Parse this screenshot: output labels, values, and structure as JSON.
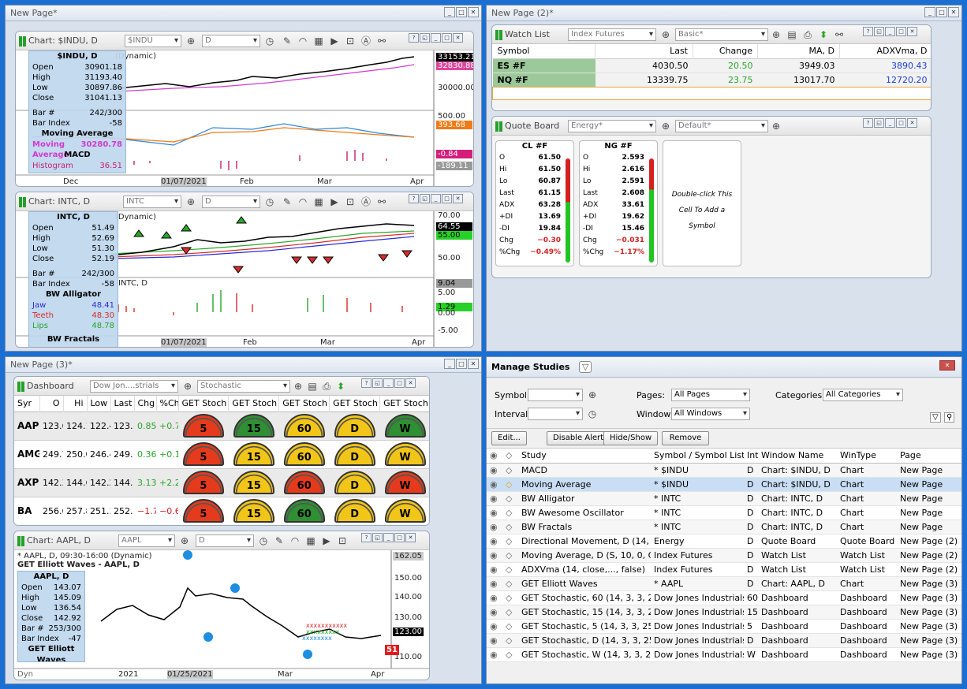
{
  "win1": {
    "title": "New Page*"
  },
  "win2": {
    "title": "New Page (2)*"
  },
  "win3": {
    "title": "New Page (3)*"
  },
  "chart_indu": {
    "title": "Chart: $INDU, D",
    "symbol": "$INDU",
    "interval": "D",
    "legend_title": "$INDU, D",
    "rows": [
      [
        "Open",
        "30901.18"
      ],
      [
        "High",
        "31193.40"
      ],
      [
        "Low",
        "30897.86"
      ],
      [
        "Close",
        "31041.13"
      ]
    ],
    "rows2": [
      [
        "Bar #",
        "242/300"
      ],
      [
        "Bar Index",
        "-58"
      ]
    ],
    "ma_title": "Moving Average",
    "ma_label": "Moving Average",
    "ma_value": "30280.78",
    "macd_title": "MACD",
    "hist_label": "Histogram",
    "hist_value": "36.51",
    "ghost1": "$INDU, D",
    "ghost2": "Moving Average",
    "ghost3": "(Dynamic)",
    "price_ticks": [
      "33153.21",
      "32830.88",
      "30000.00"
    ],
    "ind_ticks": [
      "500.00",
      "393.68",
      "-0.84",
      "-189.11"
    ],
    "xlabels": [
      "Dec",
      "01/07/2021",
      "Feb",
      "Mar",
      "Apr"
    ],
    "dyn": "D"
  },
  "chart_intc": {
    "title": "Chart: INTC, D",
    "symbol": "INTC",
    "interval": "D",
    "legend_title": "INTC, D",
    "rows": [
      [
        "Open",
        "51.49"
      ],
      [
        "High",
        "52.69"
      ],
      [
        "Low",
        "51.30"
      ],
      [
        "Close",
        "52.19"
      ]
    ],
    "rows2": [
      [
        "Bar #",
        "242/300"
      ],
      [
        "Bar Index",
        "-58"
      ]
    ],
    "alli_title": "BW Alligator",
    "alli": [
      [
        "Jaw",
        "48.41"
      ],
      [
        "Teeth",
        "48.30"
      ],
      [
        "Lips",
        "48.78"
      ]
    ],
    "fract_title": "BW Fractals",
    "sub_label": "INTC, D",
    "ghost1": "INTC, D",
    "ghost2": "Alligator - INTC, D",
    "ghost3": "Fractals - INTC, D",
    "ghost4": "Awesome Oscillator",
    "ghost5": "(Dynamic)",
    "price_ticks": [
      "70.00",
      "64.55",
      "55.00",
      "50.00"
    ],
    "ind_ticks": [
      "9.04",
      "5.00",
      "1.29",
      "0.00",
      "-5.00"
    ],
    "xlabels": [
      "01/07/2021",
      "Feb",
      "Mar",
      "Apr"
    ],
    "dyn": "D"
  },
  "watchlist": {
    "title": "Watch List",
    "list": "Index Futures",
    "columns_set": "Basic*",
    "headers": [
      "Symbol",
      "Last",
      "Change",
      "MA, D",
      "ADXVma, D"
    ],
    "rows": [
      [
        "ES #F",
        "4030.50",
        "20.50",
        "3949.03",
        "3890.43"
      ],
      [
        "NQ #F",
        "13339.75",
        "23.75",
        "13017.70",
        "12720.20"
      ]
    ]
  },
  "quoteboard": {
    "title": "Quote Board",
    "list": "Energy*",
    "layout": "Default*",
    "cards": [
      {
        "sym": "CL #F",
        "rows": [
          [
            "O",
            "61.50"
          ],
          [
            "Hi",
            "61.50"
          ],
          [
            "Lo",
            "60.87"
          ],
          [
            "Last",
            "61.15"
          ],
          [
            "ADX",
            "63.28"
          ],
          [
            "+DI",
            "13.69"
          ],
          [
            "-DI",
            "19.84"
          ],
          [
            "Chg",
            "−0.30"
          ],
          [
            "%Chg",
            "−0.49%"
          ]
        ]
      },
      {
        "sym": "NG #F",
        "rows": [
          [
            "O",
            "2.593"
          ],
          [
            "Hi",
            "2.616"
          ],
          [
            "Lo",
            "2.591"
          ],
          [
            "Last",
            "2.608"
          ],
          [
            "ADX",
            "33.61"
          ],
          [
            "+DI",
            "19.62"
          ],
          [
            "-DI",
            "15.46"
          ],
          [
            "Chg",
            "−0.031"
          ],
          [
            "%Chg",
            "−1.17%"
          ]
        ]
      }
    ],
    "empty": "Double-click This Cell To Add a Symbol"
  },
  "dashboard": {
    "title": "Dashboard",
    "list": "Dow Jon....strials",
    "layout": "Stochastic",
    "headers": [
      "Syr",
      "O",
      "Hi",
      "Low",
      "Last",
      "Chg",
      "%Ch",
      "GET Stoch",
      "GET Stoch",
      "GET Stoch",
      "GET Stoch",
      "GET Stoch"
    ],
    "rows": [
      {
        "sym": "AAPL",
        "o": "123.6",
        "hi": "124.1",
        "low": "122.4",
        "last": "123.",
        "chg": "0.85",
        "pct": "+0.7",
        "g": [
          "5",
          "15",
          "60",
          "D",
          "W"
        ],
        "c": [
          "#e53b1c",
          "#2e8f33",
          "#f2c619",
          "#f2c619",
          "#2e8f33"
        ]
      },
      {
        "sym": "AMGI",
        "o": "249.7",
        "hi": "250.0",
        "low": "246.4",
        "last": "249.",
        "chg": "0.36",
        "pct": "+0.1",
        "g": [
          "5",
          "15",
          "60",
          "D",
          "W"
        ],
        "c": [
          "#e53b1c",
          "#f2c619",
          "#f2c619",
          "#f2c619",
          "#f2c619"
        ]
      },
      {
        "sym": "AXP",
        "o": "142.3",
        "hi": "144.6",
        "low": "142.2",
        "last": "144.",
        "chg": "3.13",
        "pct": "+2.2",
        "g": [
          "5",
          "15",
          "60",
          "D",
          "W"
        ],
        "c": [
          "#e53b1c",
          "#f2c619",
          "#e53b1c",
          "#f2c619",
          "#e53b1c"
        ]
      },
      {
        "sym": "BA",
        "o": "256.6",
        "hi": "257.8",
        "low": "251.3",
        "last": "252.",
        "chg": "−1.76",
        "pct": "−0.6",
        "g": [
          "5",
          "15",
          "60",
          "D",
          "W"
        ],
        "c": [
          "#e53b1c",
          "#f2c619",
          "#2e8f33",
          "#f2c619",
          "#f2c619"
        ]
      }
    ]
  },
  "chart_aapl": {
    "title": "Chart: AAPL, D",
    "symbol": "AAPL",
    "interval": "D",
    "info": "* AAPL, D, 09:30-16:00 (Dynamic)",
    "ew_label": "GET Elliott Waves - AAPL, D",
    "legend_title": "AAPL, D",
    "rows": [
      [
        "Open",
        "143.07"
      ],
      [
        "High",
        "145.09"
      ],
      [
        "Low",
        "136.54"
      ],
      [
        "Close",
        "142.92"
      ],
      [
        "Bar #",
        "253/300"
      ],
      [
        "Bar Index",
        "-47"
      ]
    ],
    "ew_title": "GET Elliott Waves",
    "price_ticks": [
      "162.05",
      "150.00",
      "140.00",
      "130.00",
      "123.00",
      "110.00"
    ],
    "xlabels": [
      "2021",
      "01/25/2021",
      "Mar",
      "Apr"
    ],
    "badge": "51",
    "dyn": "Dyn"
  },
  "studies": {
    "title": "Manage Studies",
    "symbol_label": "Symbol:",
    "interval_label": "Interval:",
    "pages_label": "Pages:",
    "pages_value": "All Pages",
    "windows_label": "Windows:",
    "windows_value": "All Windows",
    "categories_label": "Categories:",
    "categories_value": "All Categories",
    "buttons": [
      "Edit...",
      "Disable Alert",
      "Hide/Show",
      "Remove"
    ],
    "headers": [
      "Study",
      "Symbol / Symbol List",
      "Inte",
      "Window Name",
      "WinType",
      "Page"
    ],
    "rows": [
      [
        "MACD",
        "* $INDU",
        "D",
        "Chart: $INDU, D",
        "Chart",
        "New Page"
      ],
      [
        "Moving Average",
        "* $INDU",
        "D",
        "Chart: $INDU, D",
        "Chart",
        "New Page"
      ],
      [
        "BW Alligator",
        "* INTC",
        "D",
        "Chart: INTC, D",
        "Chart",
        "New Page"
      ],
      [
        "BW Awesome Oscillator",
        "* INTC",
        "D",
        "Chart: INTC, D",
        "Chart",
        "New Page"
      ],
      [
        "BW Fractals",
        "* INTC",
        "D",
        "Chart: INTC, D",
        "Chart",
        "New Page"
      ],
      [
        "Directional Movement, D (14, 14)",
        "Energy",
        "D",
        "Quote Board",
        "Quote Board",
        "New Page (2)"
      ],
      [
        "Moving Average, D (S, 10, 0, C)",
        "Index Futures",
        "D",
        "Watch List",
        "Watch List",
        "New Page (2)"
      ],
      [
        "ADXVma (14, close,..., false)",
        "Index Futures",
        "D",
        "Watch List",
        "Watch List",
        "New Page (2)"
      ],
      [
        "GET Elliott Waves",
        "* AAPL",
        "D",
        "Chart: AAPL, D",
        "Chart",
        "New Page (3)"
      ],
      [
        "GET Stochastic, 60 (14, 3, 3, 25,",
        "Dow Jones Industrials",
        "60",
        "Dashboard",
        "Dashboard",
        "New Page (3)"
      ],
      [
        "GET Stochastic, 15 (14, 3, 3, 25,",
        "Dow Jones Industrials",
        "15",
        "Dashboard",
        "Dashboard",
        "New Page (3)"
      ],
      [
        "GET Stochastic, 5 (14, 3, 3, 25,",
        "Dow Jones Industrials",
        "5",
        "Dashboard",
        "Dashboard",
        "New Page (3)"
      ],
      [
        "GET Stochastic, D (14, 3, 3, 25,",
        "Dow Jones Industrials",
        "D",
        "Dashboard",
        "Dashboard",
        "New Page (3)"
      ],
      [
        "GET Stochastic, W (14, 3, 3, 25,",
        "Dow Jones Industrials",
        "W",
        "Dashboard",
        "Dashboard",
        "New Page (3)"
      ]
    ]
  }
}
